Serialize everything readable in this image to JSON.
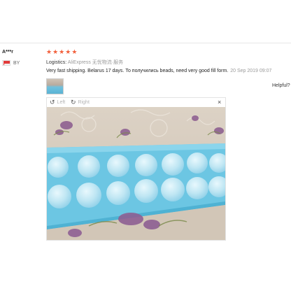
{
  "review": {
    "reviewer": "A***r",
    "country": "BY",
    "stars": [
      "★",
      "★",
      "★",
      "★",
      "★"
    ],
    "logistics_label": "Logistics:",
    "logistics_value": "AliExpress 无忧物流·服务",
    "feedback": "Very fast shipping. Belarus 17 days. То получились beads, need very good fill form.",
    "date": "20 Sep 2019 09:07",
    "helpful_label": "Helpful?"
  },
  "viewer": {
    "left_label": "Left",
    "right_label": "Right",
    "left_glyph": "↺",
    "right_glyph": "↻",
    "close_glyph": "×"
  },
  "colors": {
    "star": "#f2603c",
    "muted": "#9a9a9a",
    "tray": "#6cc6e3",
    "tablecloth": "#d7cdbf"
  }
}
